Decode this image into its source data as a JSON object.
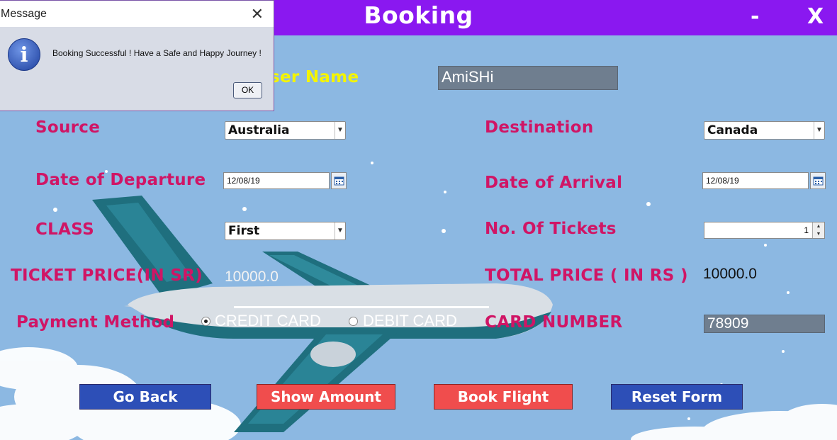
{
  "window": {
    "title": "Booking",
    "minimize_label": "-",
    "close_label": "X"
  },
  "form": {
    "user_name_label": "User Name",
    "user_name_value": "AmiSHi",
    "source_label": "Source",
    "source_value": "Australia",
    "destination_label": "Destination",
    "destination_value": "Canada",
    "departure_label": "Date of Departure",
    "departure_value": "12/08/19",
    "arrival_label": "Date of Arrival",
    "arrival_value": "12/08/19",
    "class_label": "CLASS",
    "class_value": "First",
    "tickets_label": "No. Of Tickets",
    "tickets_value": "1",
    "ticket_price_label": "TICKET PRICE(IN SR)",
    "ticket_price_value": "10000.0",
    "total_price_label": "TOTAL PRICE ( IN RS )",
    "total_price_value": "10000.0",
    "payment_label": "Payment Method",
    "payment_options": [
      "CREDIT CARD",
      "DEBIT CARD"
    ],
    "payment_selected": "CREDIT CARD",
    "card_number_label": "CARD NUMBER",
    "card_number_value": "78909"
  },
  "buttons": {
    "go_back": "Go Back",
    "show_amount": "Show Amount",
    "book_flight": "Book Flight",
    "reset_form": "Reset Form"
  },
  "dialog": {
    "title": "Message",
    "close_label": "✕",
    "message": "Booking Successful ! Have a Safe and Happy Journey !",
    "ok_label": "OK",
    "icon": "info-icon"
  },
  "colors": {
    "title_bar": "#8a18f0",
    "label": "#d01565",
    "user_label": "#f4f400",
    "button_blue": "#2d4fb7",
    "button_red": "#f04d4d"
  }
}
